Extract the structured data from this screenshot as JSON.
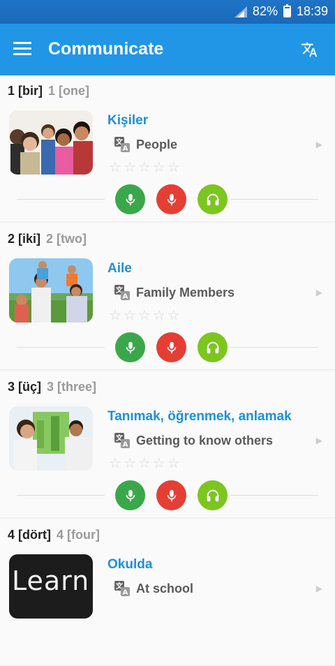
{
  "status_bar": {
    "battery": "82%",
    "time": "18:39"
  },
  "app_bar": {
    "title": "Communicate",
    "menu_icon": "menu-icon",
    "translate_icon": "translate-icon"
  },
  "colors": {
    "app_bar": "#2196e6",
    "title": "#1e8fd8",
    "mic_green": "#3aa84a",
    "mic_red": "#e53e34",
    "headphones": "#7cc620"
  },
  "sections": [
    {
      "number": "1 [bir]",
      "english": "1 [one]",
      "title": "Kişiler",
      "translation": "People",
      "rating": 0,
      "image_icon": "group-photo"
    },
    {
      "number": "2 [iki]",
      "english": "2 [two]",
      "title": "Aile",
      "translation": "Family Members",
      "rating": 0,
      "image_icon": "family-photo"
    },
    {
      "number": "3 [üç]",
      "english": "3 [three]",
      "title": "Tanımak, öğrenmek, anlamak",
      "translation": "Getting to know others",
      "rating": 0,
      "image_icon": "couple-photo"
    },
    {
      "number": "4 [dört]",
      "english": "4 [four]",
      "title": "Okulda",
      "translation": "At school",
      "rating": 0,
      "image_text": "Learn"
    }
  ]
}
